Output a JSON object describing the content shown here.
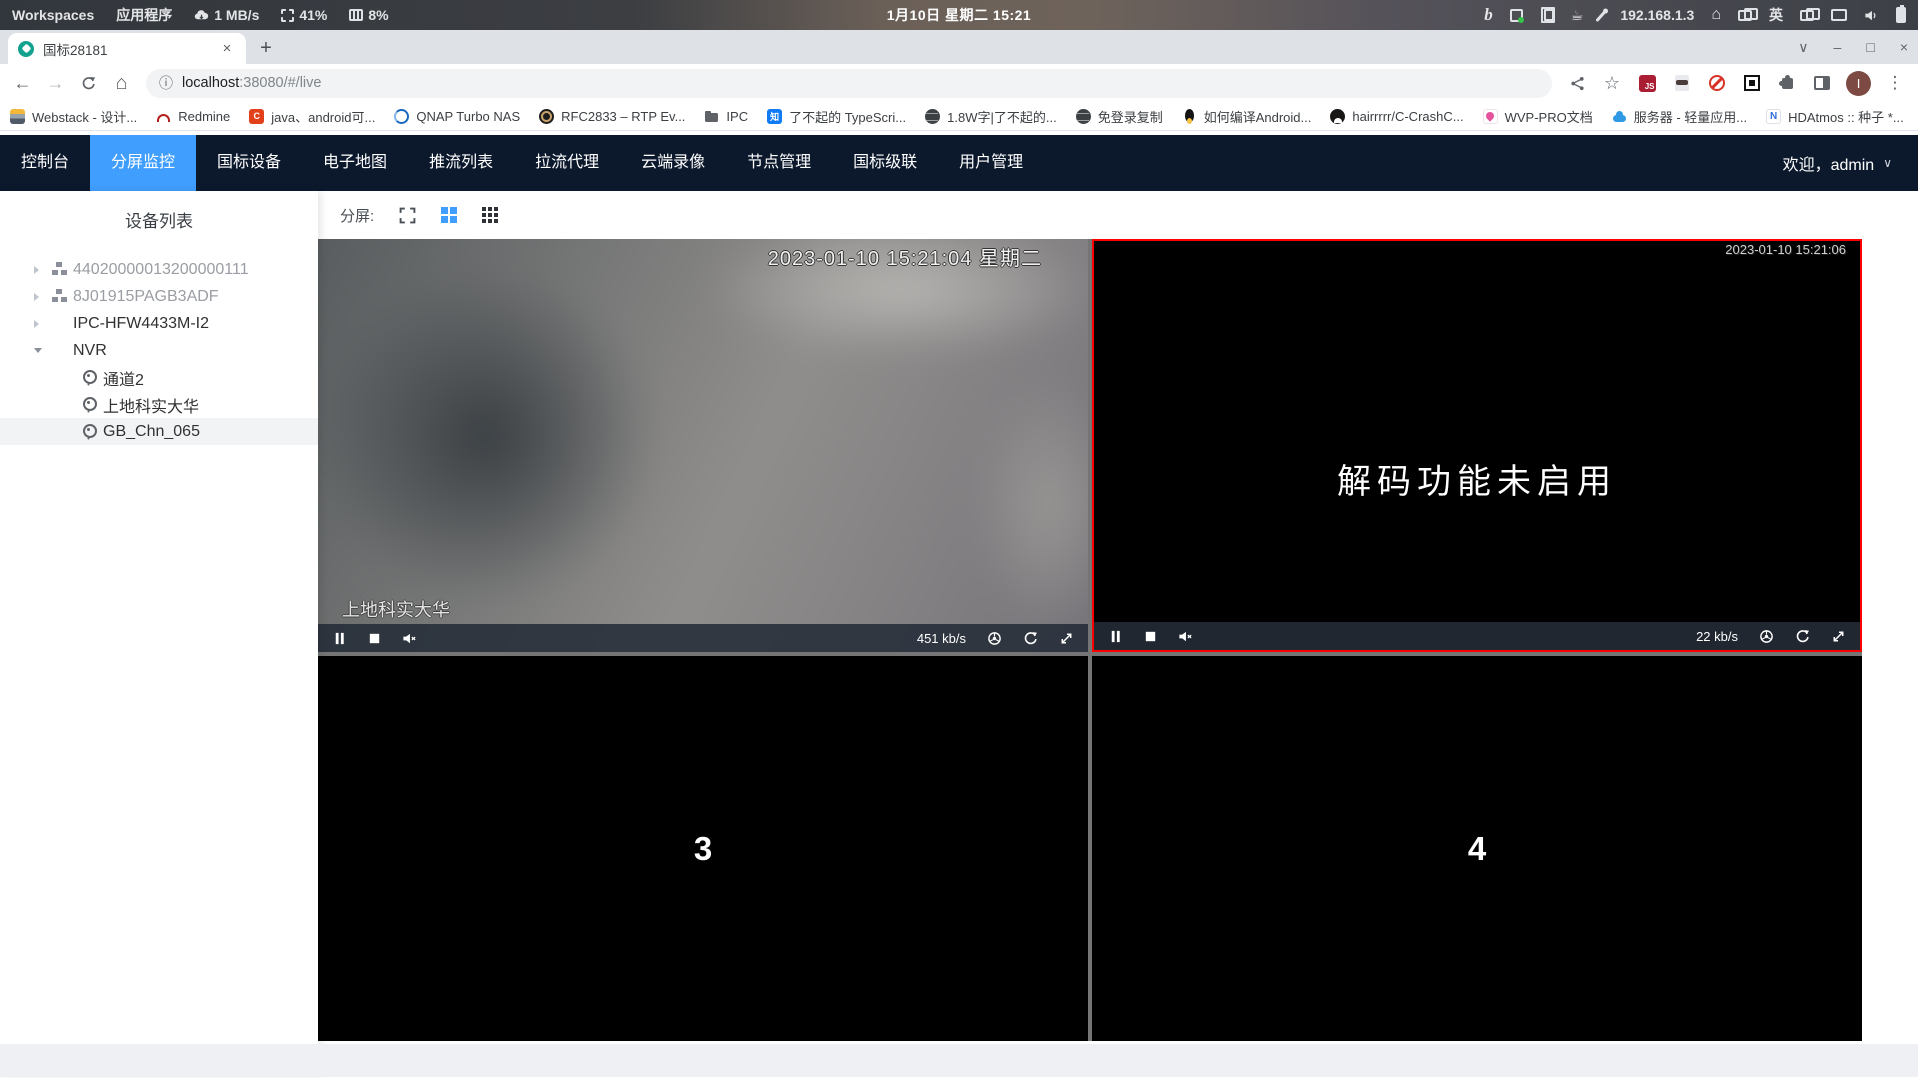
{
  "system_bar": {
    "workspaces": "Workspaces",
    "applications": "应用程序",
    "network_speed": "1 MB/s",
    "cpu_usage": "41%",
    "memory_usage": "8%",
    "clock": "1月10日 星期二 15:21",
    "ip_address": "192.168.1.3",
    "input_method": "英"
  },
  "browser": {
    "tab_title": "国标28181",
    "url_host": "localhost",
    "url_path": ":38080/#/live",
    "profile_initial": "I",
    "js_badge": "JS"
  },
  "glyphs": {
    "plus": "+",
    "close": "×",
    "minimize": "–",
    "maximize": "□",
    "chevron_down": "∨",
    "back": "←",
    "forward": "→",
    "home": "⌂",
    "info": "ⓘ",
    "star": "☆",
    "kebab": "⋮",
    "overflow": "»",
    "cloud": "☁",
    "coffee": "☕",
    "bing": "b"
  },
  "bookmarks": [
    {
      "label": "Webstack - 设计...",
      "icon": "layers"
    },
    {
      "label": "Redmine",
      "icon": "redmine"
    },
    {
      "label": "java、android可...",
      "icon": "c"
    },
    {
      "label": "QNAP Turbo NAS",
      "icon": "qnap"
    },
    {
      "label": "RFC2833 – RTP Ev...",
      "icon": "lens"
    },
    {
      "label": "IPC",
      "icon": "folder"
    },
    {
      "label": "了不起的 TypeScri...",
      "icon": "zhihu"
    },
    {
      "label": "1.8W字|了不起的...",
      "icon": "globe"
    },
    {
      "label": "免登录复制",
      "icon": "globe"
    },
    {
      "label": "如何编译Android...",
      "icon": "tux"
    },
    {
      "label": "hairrrrr/C-CrashC...",
      "icon": "github"
    },
    {
      "label": "WVP-PRO文档",
      "icon": "wvp"
    },
    {
      "label": "服务器 - 轻量应用...",
      "icon": "cloud"
    },
    {
      "label": "HDAtmos :: 种子 *...",
      "icon": "notion"
    }
  ],
  "nav": {
    "items": [
      {
        "label": "控制台"
      },
      {
        "label": "分屏监控",
        "active": true
      },
      {
        "label": "国标设备"
      },
      {
        "label": "电子地图"
      },
      {
        "label": "推流列表"
      },
      {
        "label": "拉流代理"
      },
      {
        "label": "云端录像"
      },
      {
        "label": "节点管理"
      },
      {
        "label": "国标级联"
      },
      {
        "label": "用户管理"
      }
    ],
    "welcome": "欢迎，admin"
  },
  "sidebar": {
    "title": "设备列表",
    "tree": [
      {
        "label": "44020000013200000111",
        "arrow": "right",
        "icon": "hub",
        "muted": true
      },
      {
        "label": "8J01915PAGB3ADF",
        "arrow": "right",
        "icon": "hub",
        "muted": true
      },
      {
        "label": "IPC-HFW4433M-I2",
        "arrow": "right"
      },
      {
        "label": "NVR",
        "arrow": "down"
      },
      {
        "label": "通道2",
        "icon": "camera",
        "child": true
      },
      {
        "label": "上地科实大华",
        "icon": "camera",
        "child": true
      },
      {
        "label": "GB_Chn_065",
        "icon": "camera",
        "child": true,
        "selected": true
      }
    ]
  },
  "toolbar": {
    "split_label": "分屏:"
  },
  "players": [
    {
      "osd": "2023-01-10 15:21:04 星期二",
      "channel_name": "上地科实大华",
      "bitrate": "451 kb/s"
    },
    {
      "osd": "2023-01-10 15:21:06",
      "message": "解码功能未启用",
      "bitrate": "22 kb/s",
      "selected": true
    },
    {
      "placeholder": "3"
    },
    {
      "placeholder": "4"
    }
  ],
  "colors": {
    "accent": "#409eff",
    "nav_bg": "#0c192d",
    "selected_border": "#ff0000",
    "favicon_teal": "#13a18f"
  }
}
